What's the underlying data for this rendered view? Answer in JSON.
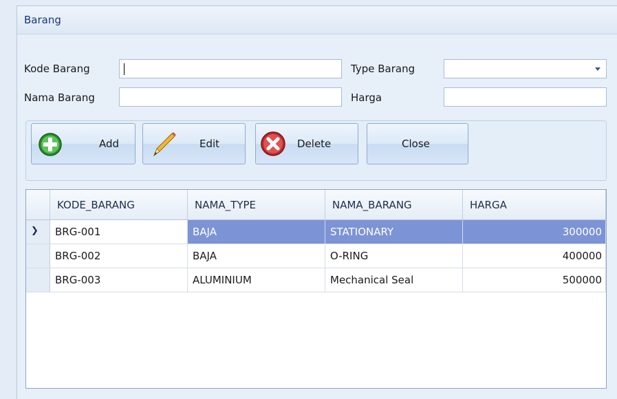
{
  "window": {
    "title": "Barang"
  },
  "form": {
    "kode_label": "Kode Barang",
    "kode_value": "",
    "type_label": "Type Barang",
    "type_value": "",
    "nama_label": "Nama Barang",
    "nama_value": "",
    "harga_label": "Harga",
    "harga_value": ""
  },
  "buttons": {
    "add": "Add",
    "edit": "Edit",
    "delete": "Delete",
    "close": "Close"
  },
  "grid": {
    "columns": [
      "KODE_BARANG",
      "NAMA_TYPE",
      "NAMA_BARANG",
      "HARGA"
    ],
    "rows": [
      [
        "BRG-001",
        "BAJA",
        "STATIONARY",
        "300000"
      ],
      [
        "BRG-002",
        "BAJA",
        "O-RING",
        "400000"
      ],
      [
        "BRG-003",
        "ALUMINIUM",
        "Mechanical Seal",
        "500000"
      ]
    ],
    "selected_row": 0
  },
  "colors": {
    "selection": "#7c93d6",
    "title_text": "#15387a"
  }
}
